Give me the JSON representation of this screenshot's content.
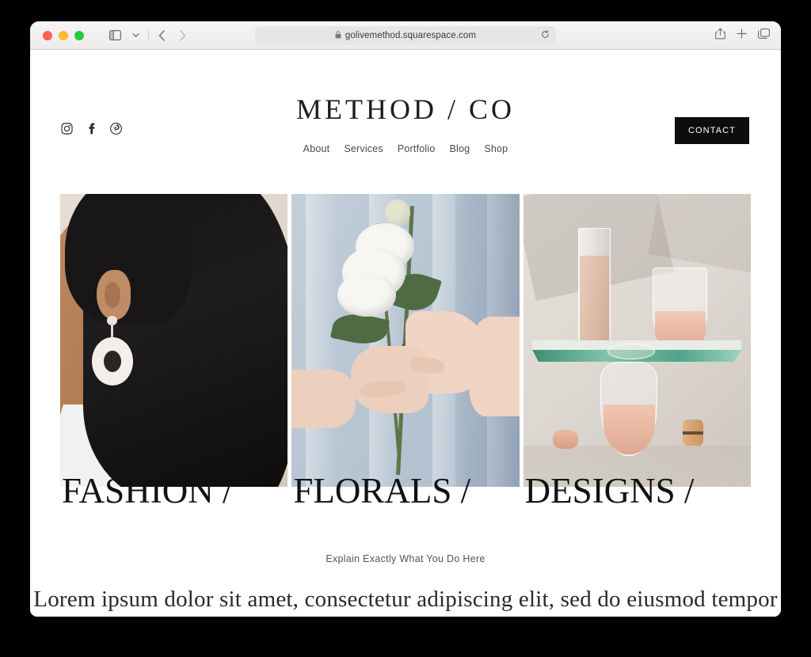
{
  "browser": {
    "url": "golivemethod.squarespace.com",
    "lock_icon": "lock-icon",
    "reload_icon": "reload-icon",
    "sidebar_icon": "sidebar-toggle-icon",
    "chevron_icon": "chevron-down-icon",
    "back_icon": "back-arrow-icon",
    "forward_icon": "forward-arrow-icon",
    "share_icon": "share-icon",
    "newtab_icon": "plus-icon",
    "tabs_icon": "tab-overview-icon",
    "traffic_lights": [
      "close-red",
      "minimize-yellow",
      "maximize-green"
    ]
  },
  "site": {
    "logo": "METHOD / CO",
    "contact_label": "CONTACT",
    "socials": [
      {
        "name": "instagram-icon",
        "label": "Instagram"
      },
      {
        "name": "facebook-icon",
        "label": "Facebook"
      },
      {
        "name": "pinterest-icon",
        "label": "Pinterest"
      }
    ],
    "nav": [
      {
        "label": "About"
      },
      {
        "label": "Services"
      },
      {
        "label": "Portfolio"
      },
      {
        "label": "Blog"
      },
      {
        "label": "Shop"
      }
    ],
    "categories": [
      {
        "label": "FASHION /",
        "alt": "Woman in profile with dark hair wearing a white circular drop earring"
      },
      {
        "label": "FLORALS /",
        "alt": "Hands holding white flowers against a light blue shirt"
      },
      {
        "label": "DESIGNS /",
        "alt": "Glassware still life with rose drinks, glass shelf and macarons"
      }
    ],
    "eyebrow": "Explain Exactly What You Do Here",
    "lede": "Lorem ipsum dolor sit amet, consectetur adipiscing elit, sed do eiusmod tempor incididunt ut labore et dolore"
  },
  "colors": {
    "accent_dark": "#0d0d0d",
    "page_bg": "#ffffff",
    "desktop_bg": "#000000",
    "toolbar_bg": "#f3f1f1",
    "text": "#2a2a2a"
  }
}
